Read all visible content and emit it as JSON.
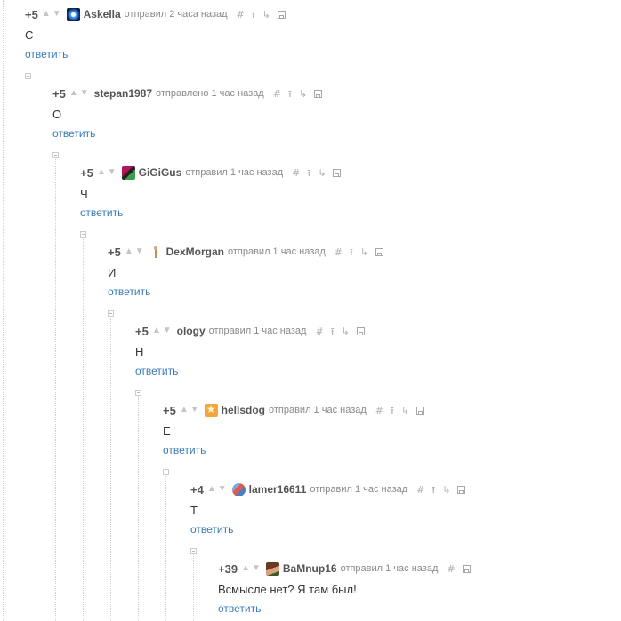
{
  "comments": [
    {
      "rating": "+5",
      "user": "Askella",
      "meta": "отправил 2 часа назад",
      "text": "С",
      "reply": "ответить",
      "avatar": "galaxy-avatar"
    },
    {
      "rating": "+5",
      "user": "stepan1987",
      "meta": "отправлено 1 час назад",
      "text": "О",
      "reply": "ответить",
      "avatar": "none"
    },
    {
      "rating": "+5",
      "user": "GiGiGus",
      "meta": "отправил 1 час назад",
      "text": "Ч",
      "reply": "ответить",
      "avatar": "pixel-avatar"
    },
    {
      "rating": "+5",
      "user": "DexMorgan",
      "meta": "отправил 1 час назад",
      "text": "И",
      "reply": "ответить",
      "avatar": "figure-avatar"
    },
    {
      "rating": "+5",
      "user": "ology",
      "meta": "отправил 1 час назад",
      "text": "Н",
      "reply": "ответить",
      "avatar": "none"
    },
    {
      "rating": "+5",
      "user": "hellsdog",
      "meta": "отправил 1 час назад",
      "text": "Е",
      "reply": "ответить",
      "avatar": "orange-avatar"
    },
    {
      "rating": "+4",
      "user": "lamer16611",
      "meta": "отправил 1 час назад",
      "text": "Т",
      "reply": "ответить",
      "avatar": "globe-avatar"
    },
    {
      "rating": "+39",
      "user": "BaMnup16",
      "meta": "отправил 1 час назад",
      "text": "Всмысле нет? Я там был!",
      "reply": "ответить",
      "avatar": "portrait-avatar"
    }
  ],
  "icons": {
    "vote_up": "▲",
    "vote_down": "▼",
    "link": "#",
    "parent": "⭱",
    "thread": "↳"
  },
  "colors": {
    "rating": "#555555",
    "username": "#555555",
    "meta": "#8a8a8a",
    "reply_link": "#3b7bb8",
    "arrows": "#c4c4c4"
  }
}
